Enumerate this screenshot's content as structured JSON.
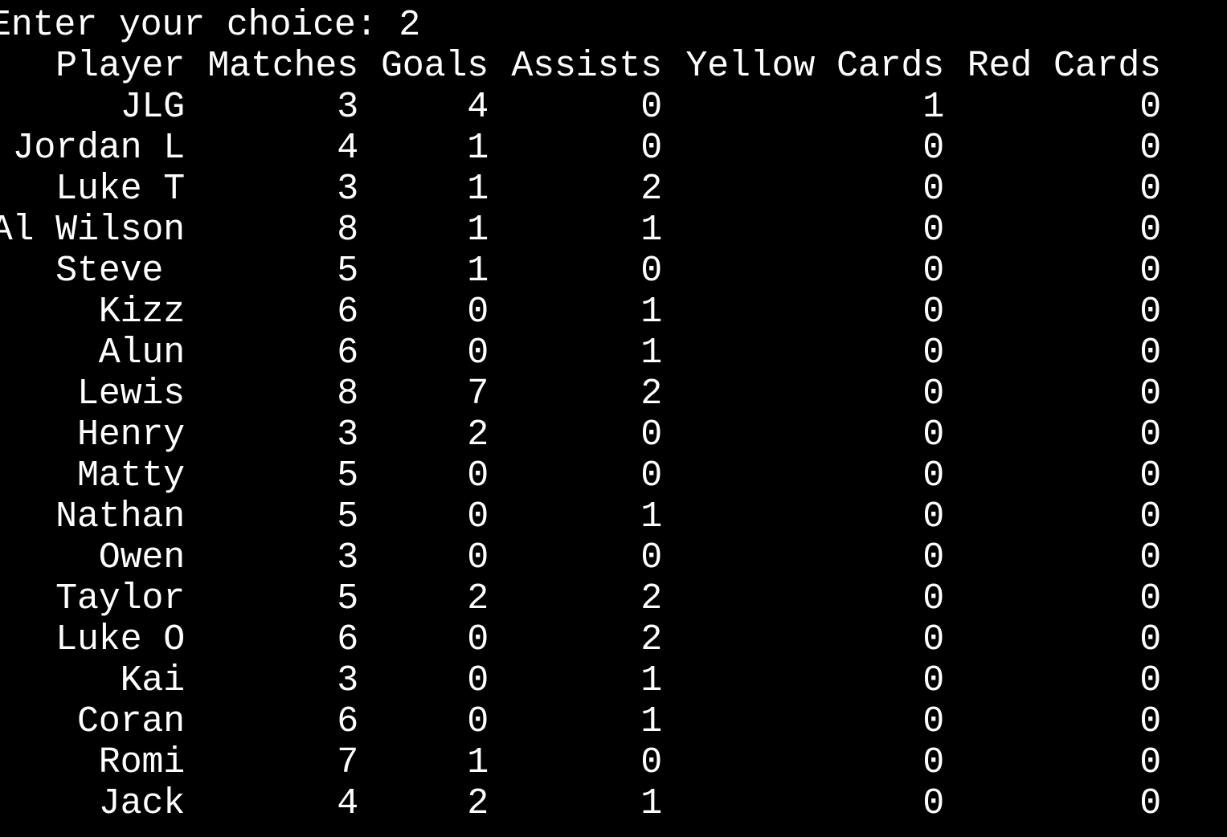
{
  "prompt": {
    "label": "Enter your choice: ",
    "value": "2"
  },
  "table": {
    "headers": [
      "Player",
      "Matches",
      "Goals",
      "Assists",
      "Yellow Cards",
      "Red Cards"
    ],
    "rows": [
      [
        "JLG",
        "3",
        "4",
        "0",
        "1",
        "0"
      ],
      [
        "Jordan L",
        "4",
        "1",
        "0",
        "0",
        "0"
      ],
      [
        "Luke T",
        "3",
        "1",
        "2",
        "0",
        "0"
      ],
      [
        "Al Wilson",
        "8",
        "1",
        "1",
        "0",
        "0"
      ],
      [
        "Steve ",
        "5",
        "1",
        "0",
        "0",
        "0"
      ],
      [
        "Kizz",
        "6",
        "0",
        "1",
        "0",
        "0"
      ],
      [
        "Alun",
        "6",
        "0",
        "1",
        "0",
        "0"
      ],
      [
        "Lewis",
        "8",
        "7",
        "2",
        "0",
        "0"
      ],
      [
        "Henry",
        "3",
        "2",
        "0",
        "0",
        "0"
      ],
      [
        "Matty",
        "5",
        "0",
        "0",
        "0",
        "0"
      ],
      [
        "Nathan",
        "5",
        "0",
        "1",
        "0",
        "0"
      ],
      [
        "Owen",
        "3",
        "0",
        "0",
        "0",
        "0"
      ],
      [
        "Taylor",
        "5",
        "2",
        "2",
        "0",
        "0"
      ],
      [
        "Luke O",
        "6",
        "0",
        "2",
        "0",
        "0"
      ],
      [
        "Kai",
        "3",
        "0",
        "1",
        "0",
        "0"
      ],
      [
        "Coran",
        "6",
        "0",
        "1",
        "0",
        "0"
      ],
      [
        "Romi",
        "7",
        "1",
        "0",
        "0",
        "0"
      ],
      [
        "Jack",
        "4",
        "2",
        "1",
        "0",
        "0"
      ]
    ]
  },
  "colors": {
    "background": "#000000",
    "text": "#ffffff"
  }
}
